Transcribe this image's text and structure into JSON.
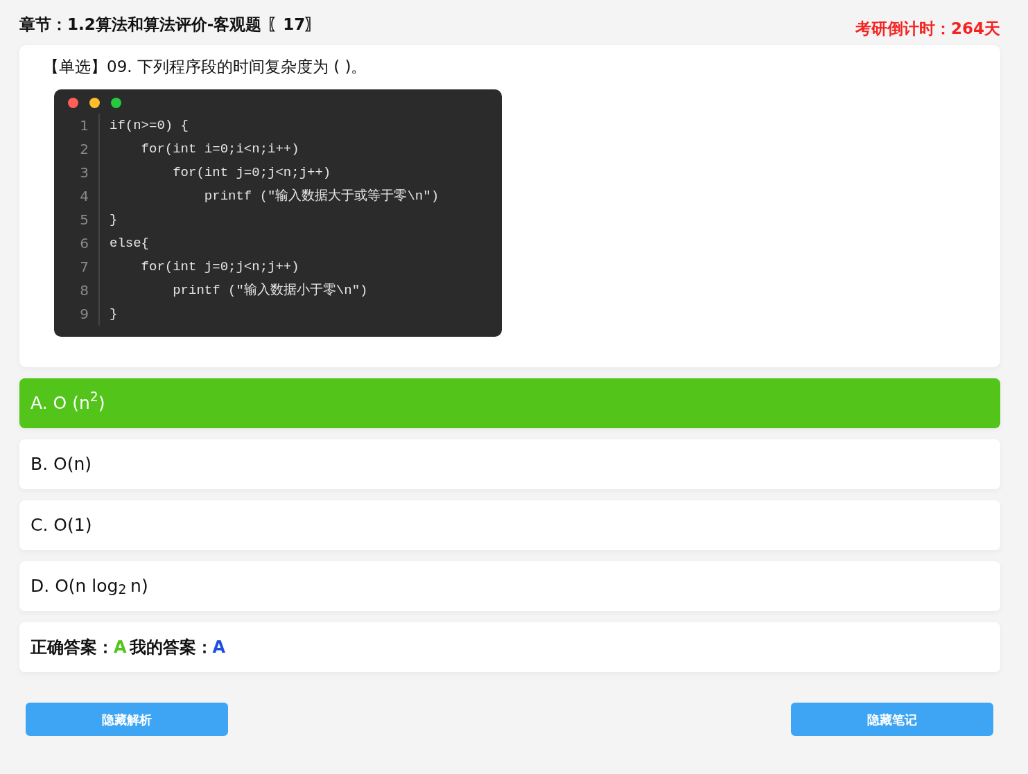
{
  "header": {
    "chapter": "章节：1.2算法和算法评价-客观题 〖17〗",
    "countdown": "考研倒计时：264天"
  },
  "question": {
    "type_tag": "【单选】",
    "text": "09. 下列程序段的时间复杂度为 ( )。"
  },
  "code": {
    "lines": [
      {
        "number": "1",
        "text": "if(n>=0) {"
      },
      {
        "number": "2",
        "text": "    for(int i=0;i<n;i++)"
      },
      {
        "number": "3",
        "text": "        for(int j=0;j<n;j++)"
      },
      {
        "number": "4",
        "text": "            printf (\"输入数据大于或等于零\\n\")"
      },
      {
        "number": "5",
        "text": "}"
      },
      {
        "number": "6",
        "text": "else{"
      },
      {
        "number": "7",
        "text": "    for(int j=0;j<n;j++)"
      },
      {
        "number": "8",
        "text": "        printf (\"输入数据小于零\\n\")"
      },
      {
        "number": "9",
        "text": "}"
      }
    ]
  },
  "options": [
    {
      "text": "A. O (n$^{2}$)",
      "selected": true
    },
    {
      "text": "B. O(n)",
      "selected": false
    },
    {
      "text": "C. O(1)",
      "selected": false
    },
    {
      "text": "D. O(n log$_{2}$ n)",
      "selected": false
    }
  ],
  "answer": {
    "correct_label": "正确答案：",
    "correct": "A",
    "mine_label": "我的答案：",
    "mine": "A"
  },
  "buttons": [
    "隐藏解析",
    "隐藏笔记"
  ]
}
